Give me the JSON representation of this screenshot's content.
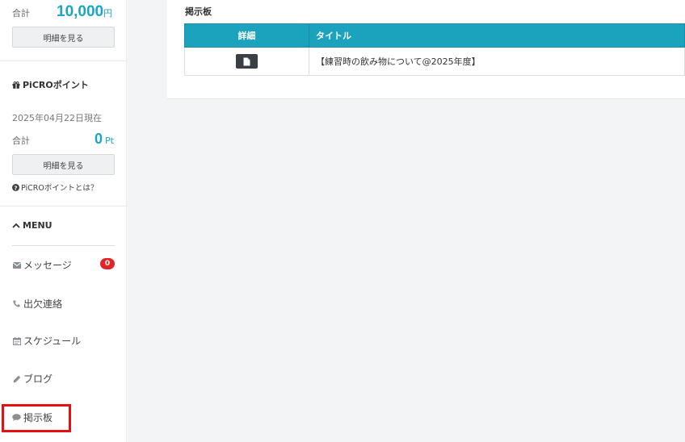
{
  "sidebar": {
    "total_label": "合計",
    "total_amount": "10,000",
    "total_unit": "円",
    "detail_button": "明細を見る",
    "picro": {
      "title": "PiCROポイント",
      "as_of": "2025年04月22日現在",
      "total_label": "合計",
      "points": "0",
      "points_unit": "Pt",
      "detail_button": "明細を見る",
      "help_link": "PiCROポイントとは？"
    },
    "menu": {
      "title": "MENU",
      "items": [
        {
          "label": "メッセージ",
          "icon": "envelope-icon",
          "badge": "0"
        },
        {
          "label": "出欠連絡",
          "icon": "phone-icon"
        },
        {
          "label": "スケジュール",
          "icon": "calendar-icon"
        },
        {
          "label": "ブログ",
          "icon": "pencil-icon"
        },
        {
          "label": "掲示板",
          "icon": "comment-icon"
        }
      ]
    }
  },
  "board": {
    "title": "掲示板",
    "columns": [
      "詳細",
      "タイトル"
    ],
    "rows": [
      {
        "title": "【練習時の飲み物について@2025年度】"
      }
    ]
  },
  "colors": {
    "accent": "#1ba3bd",
    "badge": "#e02626",
    "highlight": "#e51111"
  }
}
